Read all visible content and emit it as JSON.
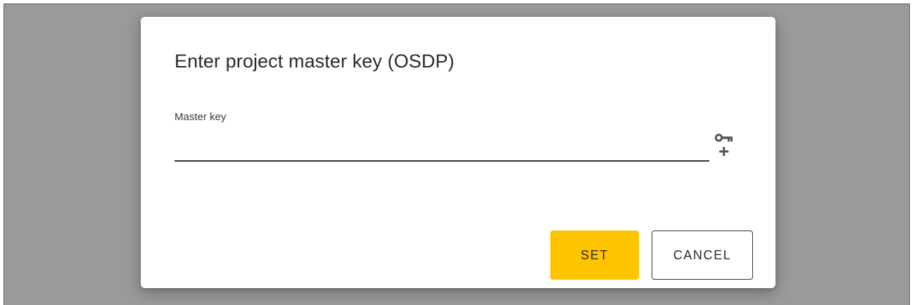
{
  "dialog": {
    "title": "Enter project master key (OSDP)",
    "field": {
      "label": "Master key",
      "value": "",
      "placeholder": ""
    },
    "generate_icon": "key-plus-icon",
    "buttons": {
      "set_label": "SET",
      "cancel_label": "CANCEL"
    }
  },
  "colors": {
    "backdrop": "#9a9a9a",
    "dialog_bg": "#ffffff",
    "primary_button": "#ffc400",
    "text": "#2a2a2a"
  }
}
